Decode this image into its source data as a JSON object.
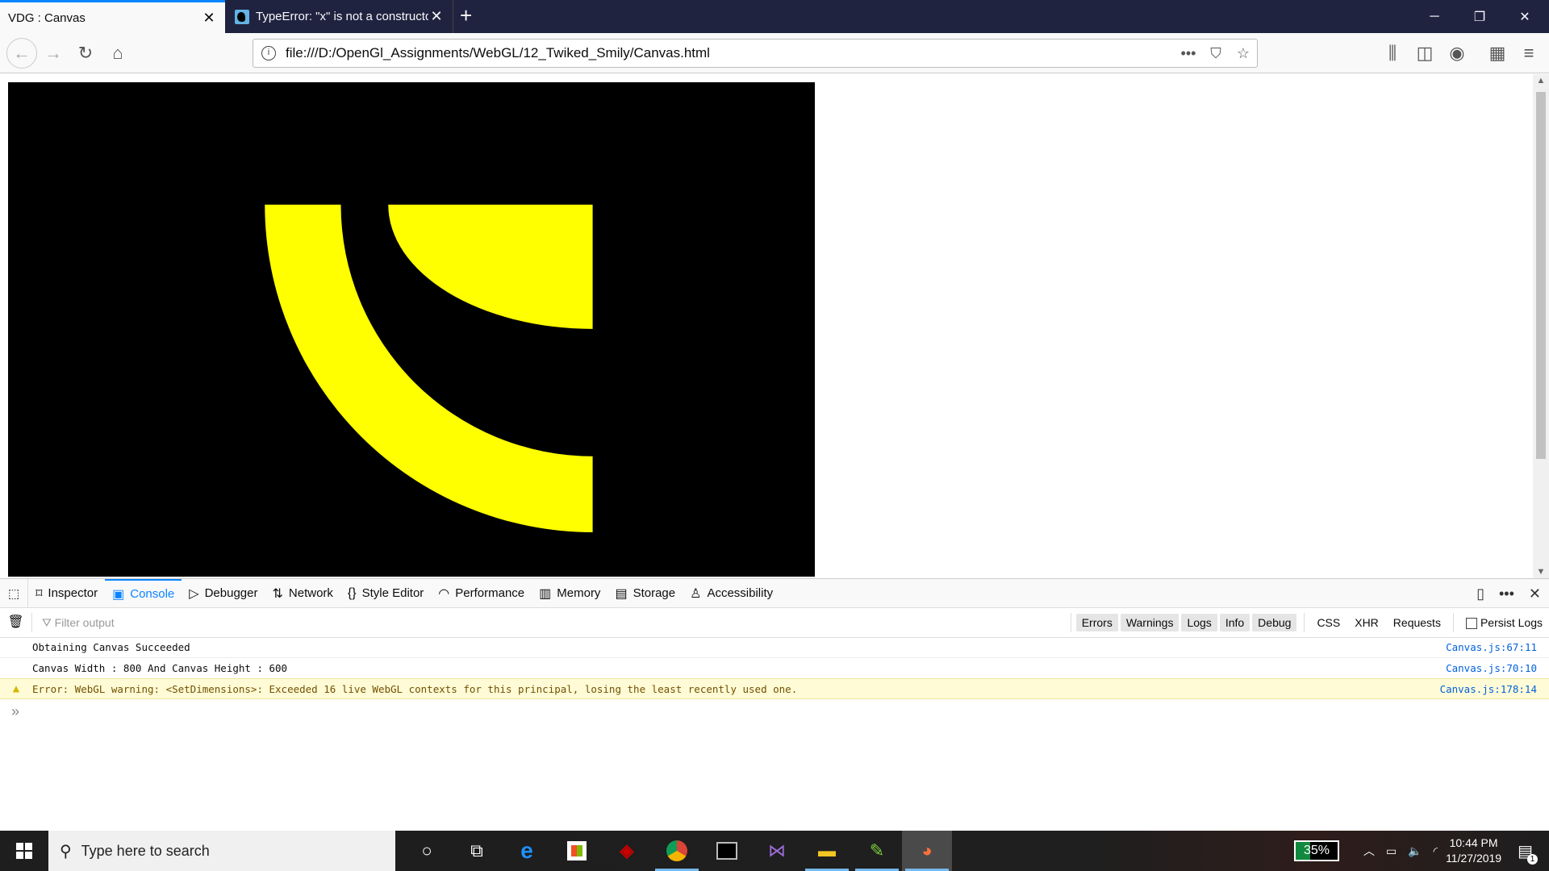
{
  "browser": {
    "tabs": [
      {
        "title": "VDG : Canvas",
        "active": true
      },
      {
        "title": "TypeError: \"x\" is not a constructor",
        "active": false
      }
    ],
    "url": "file:///D:/OpenGl_Assignments/WebGL/12_Twiked_Smily/Canvas.html"
  },
  "canvas": {
    "background": "#000000",
    "shape_color": "#ffff00"
  },
  "devtools": {
    "tabs": [
      "Inspector",
      "Console",
      "Debugger",
      "Network",
      "Style Editor",
      "Performance",
      "Memory",
      "Storage",
      "Accessibility"
    ],
    "selected_tab": "Console",
    "filter_placeholder": "Filter output",
    "level_buttons": [
      "Errors",
      "Warnings",
      "Logs",
      "Info",
      "Debug"
    ],
    "type_buttons": [
      "CSS",
      "XHR",
      "Requests"
    ],
    "persist_logs": "Persist Logs",
    "messages": [
      {
        "text": "Obtaining Canvas Succeeded",
        "source": "Canvas.js:67:11",
        "level": "log"
      },
      {
        "text": "Canvas Width : 800 And Canvas Height : 600",
        "source": "Canvas.js:70:10",
        "level": "log"
      },
      {
        "text": "Error: WebGL warning: <SetDimensions>: Exceeded 16 live WebGL contexts for this principal, losing the least recently used one.",
        "source": "Canvas.js:178:14",
        "level": "warning"
      }
    ]
  },
  "taskbar": {
    "search_placeholder": "Type here to search",
    "battery": "35%",
    "time": "10:44 PM",
    "date": "11/27/2019",
    "notifications": "1"
  }
}
